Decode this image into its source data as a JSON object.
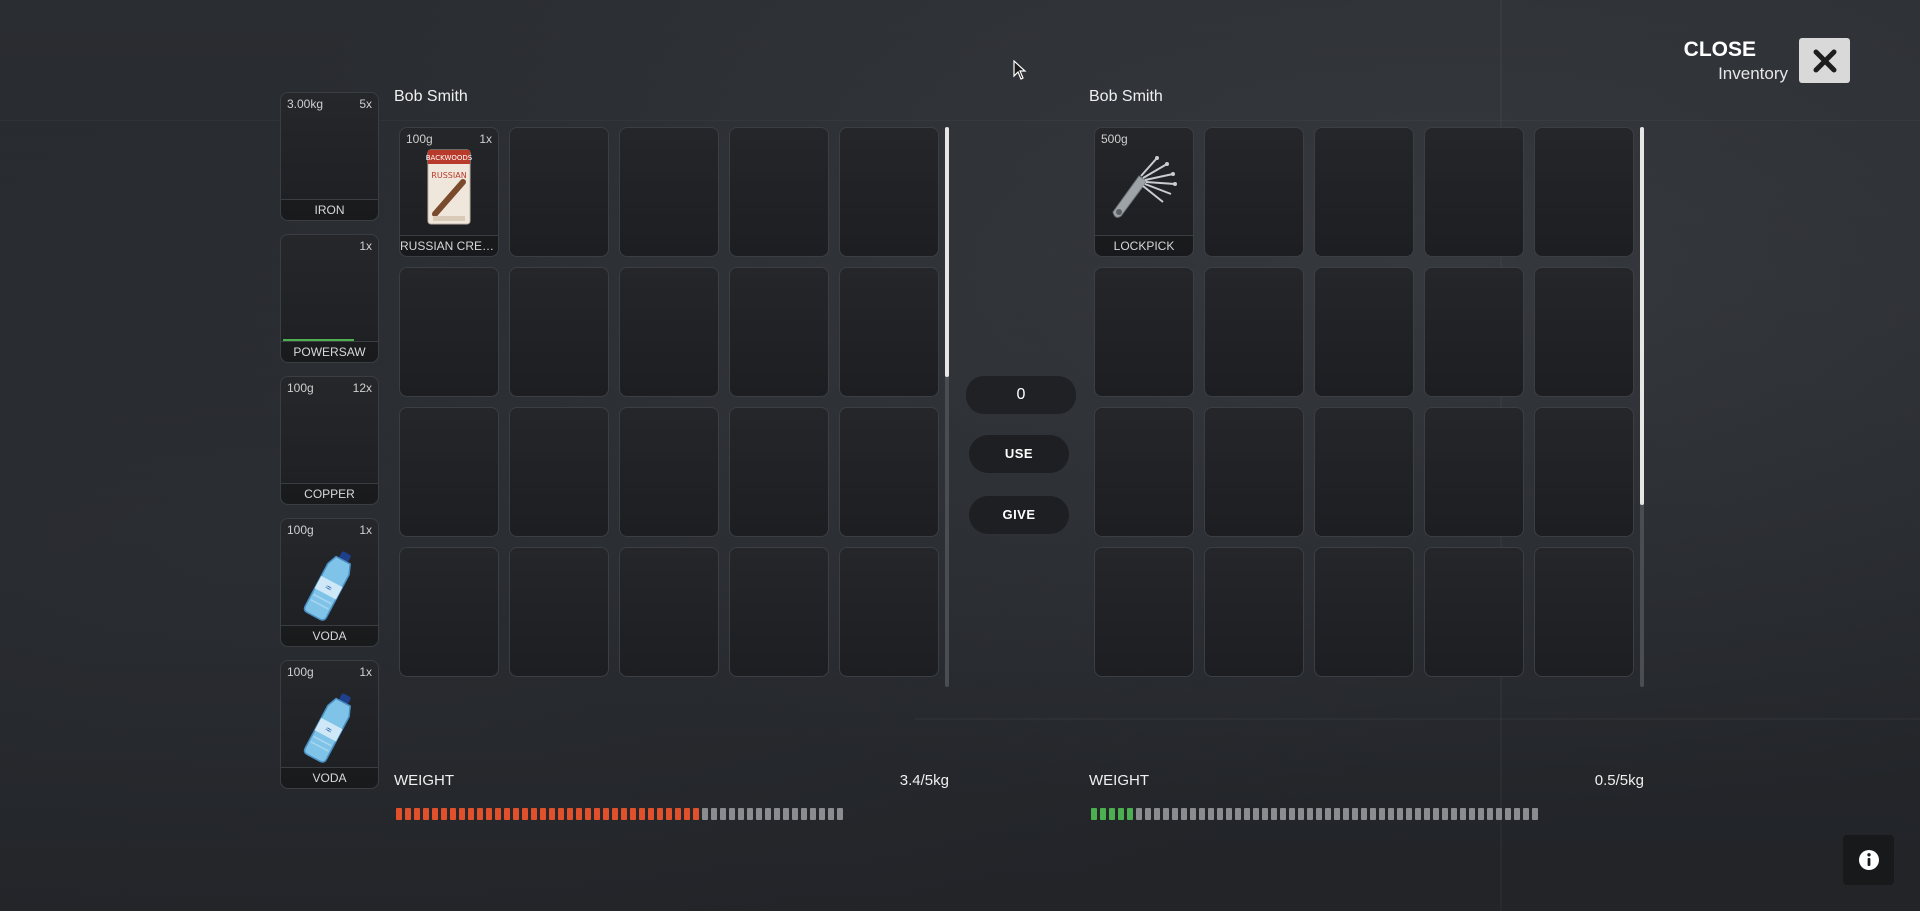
{
  "header": {
    "close_label": "CLOSE",
    "inventory_label": "Inventory"
  },
  "hotbar": [
    {
      "weight": "3.00kg",
      "count": "5x",
      "label": "IRON",
      "icon": "iron-icon"
    },
    {
      "weight": "",
      "count": "1x",
      "label": "POWERSAW",
      "icon": "powersaw-icon",
      "durability": 0.75
    },
    {
      "weight": "100g",
      "count": "12x",
      "label": "COPPER",
      "icon": "copper-icon"
    },
    {
      "weight": "100g",
      "count": "1x",
      "label": "VODA",
      "icon": "water-bottle-icon"
    },
    {
      "weight": "100g",
      "count": "1x",
      "label": "VODA",
      "icon": "water-bottle-icon"
    }
  ],
  "left_panel": {
    "title": "Bob Smith",
    "items": [
      {
        "slot": 0,
        "weight": "100g",
        "count": "1x",
        "label": "RUSSIAN CREA...",
        "icon": "cigar-pack-icon"
      }
    ],
    "weight_label": "WEIGHT",
    "weight_value": "3.4/5kg",
    "weight_fraction": 0.68,
    "weight_color": "#e0502a"
  },
  "right_panel": {
    "title": "Bob Smith",
    "items": [
      {
        "slot": 0,
        "weight": "500g",
        "count": "",
        "label": "LOCKPICK",
        "icon": "lockpick-icon"
      }
    ],
    "weight_label": "WEIGHT",
    "weight_value": "0.5/5kg",
    "weight_fraction": 0.1,
    "weight_color": "#4caf50"
  },
  "controls": {
    "amount_value": "0",
    "use_label": "USE",
    "give_label": "GIVE"
  },
  "colors": {
    "bar_empty": "#8a8c8f"
  }
}
